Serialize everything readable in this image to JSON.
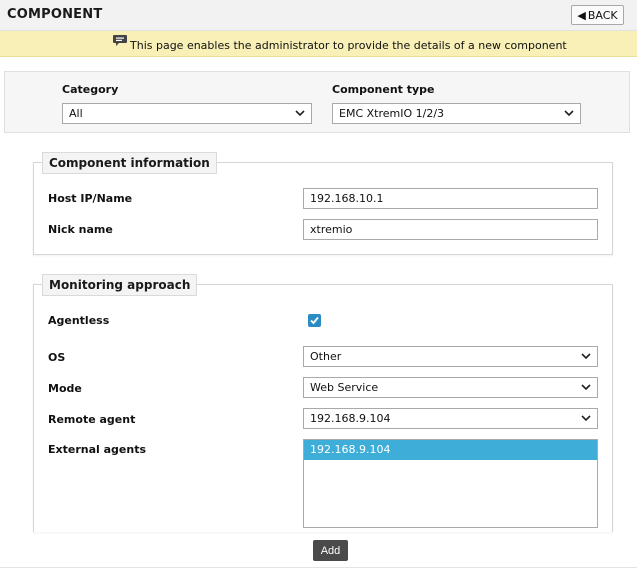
{
  "header": {
    "title": "COMPONENT",
    "back_label": "BACK"
  },
  "info": {
    "text": "This page enables the administrator to provide the details of a new component"
  },
  "selection": {
    "category_label": "Category",
    "category_value": "All",
    "component_type_label": "Component type",
    "component_type_value": "EMC XtremIO 1/2/3"
  },
  "component_info": {
    "legend": "Component information",
    "host_label": "Host IP/Name",
    "host_value": "192.168.10.1",
    "nick_label": "Nick name",
    "nick_value": "xtremio"
  },
  "monitoring": {
    "legend": "Monitoring approach",
    "agentless_label": "Agentless",
    "agentless_checked": true,
    "os_label": "OS",
    "os_value": "Other",
    "mode_label": "Mode",
    "mode_value": "Web Service",
    "remote_agent_label": "Remote agent",
    "remote_agent_value": "192.168.9.104",
    "external_agents_label": "External agents",
    "external_agents": [
      "192.168.9.104"
    ]
  },
  "actions": {
    "add_label": "Add"
  },
  "colors": {
    "info_bg": "#f8f0b7",
    "checkbox": "#2b8cc4",
    "list_selected": "#3eaed8",
    "add_button": "#4a4a4a"
  },
  "icons": {
    "info": "speech-bubble-icon",
    "back": "back-arrow-icon",
    "dropdown": "chevron-down-icon",
    "check": "check-icon"
  }
}
